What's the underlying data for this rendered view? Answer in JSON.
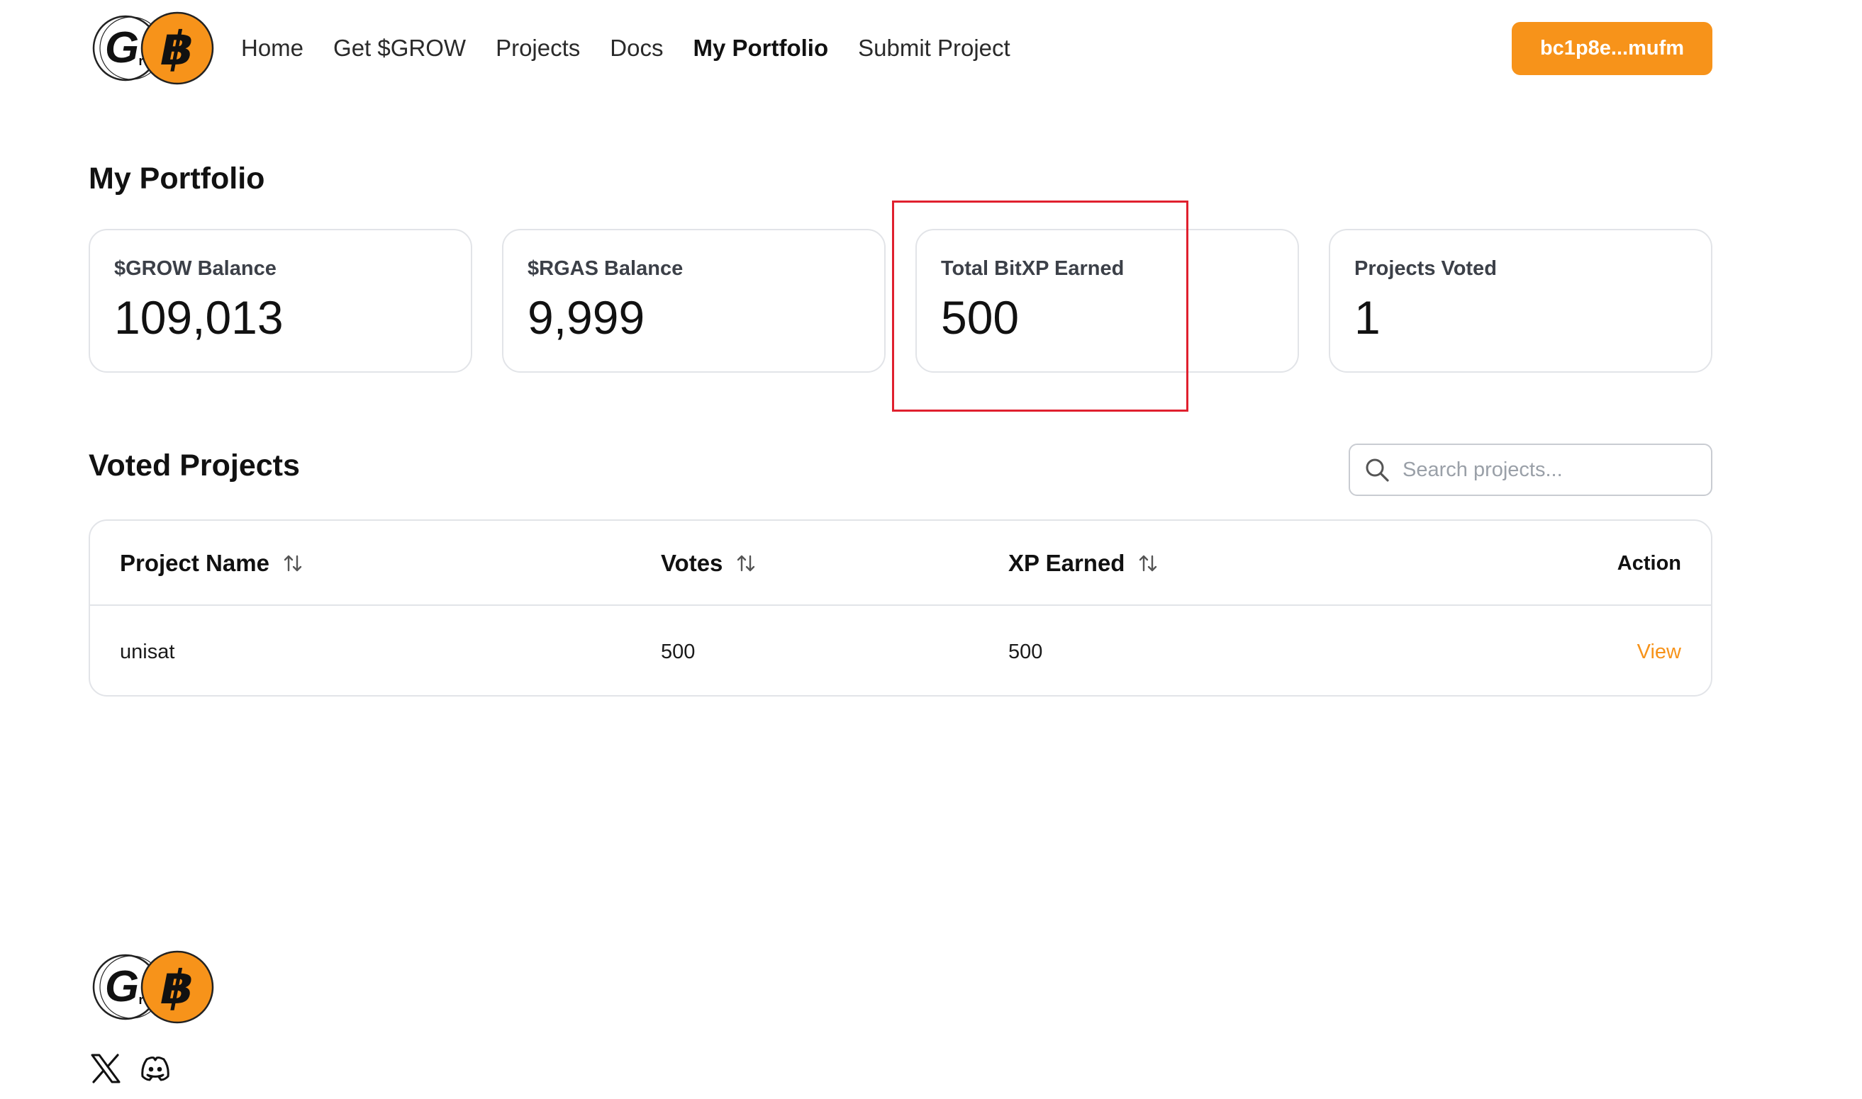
{
  "brand": {
    "logo_letter_left": "G",
    "logo_letter_sub": "r",
    "logo_letter_right": "฿",
    "accent_color": "#f7931a"
  },
  "nav": {
    "items": [
      {
        "label": "Home"
      },
      {
        "label": "Get $GROW"
      },
      {
        "label": "Projects"
      },
      {
        "label": "Docs"
      },
      {
        "label": "My Portfolio",
        "active": true
      },
      {
        "label": "Submit Project"
      }
    ]
  },
  "wallet": {
    "label": "bc1p8e...mufm"
  },
  "portfolio": {
    "title": "My Portfolio",
    "stats": [
      {
        "label": "$GROW Balance",
        "value": "109,013"
      },
      {
        "label": "$RGAS Balance",
        "value": "9,999"
      },
      {
        "label": "Total BitXP Earned",
        "value": "500"
      },
      {
        "label": "Projects Voted",
        "value": "1"
      }
    ]
  },
  "voted": {
    "title": "Voted Projects",
    "search_placeholder": "Search projects...",
    "columns": {
      "name": "Project Name",
      "votes": "Votes",
      "xp": "XP Earned",
      "action": "Action"
    },
    "rows": [
      {
        "name": "unisat",
        "votes": "500",
        "xp": "500",
        "action": "View"
      }
    ]
  },
  "footer": {
    "social": [
      {
        "icon": "x-twitter-icon"
      },
      {
        "icon": "discord-icon"
      }
    ]
  }
}
